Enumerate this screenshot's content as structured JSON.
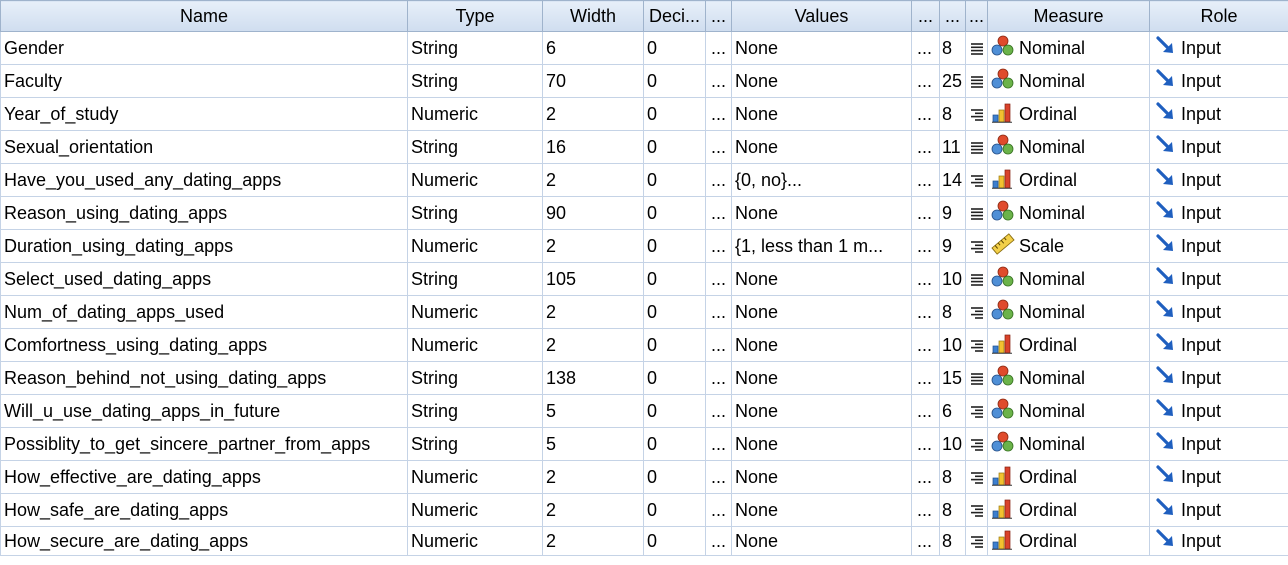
{
  "columns": {
    "name": "Name",
    "type": "Type",
    "width": "Width",
    "decimals": "Deci...",
    "label": "...",
    "values": "Values",
    "missing": "...",
    "cols": "...",
    "align": "...",
    "measure": "Measure",
    "role": "Role"
  },
  "icons": {
    "nominal": "nominal-circles-icon",
    "ordinal": "ordinal-bars-icon",
    "scale": "scale-ruler-icon",
    "input": "input-arrow-icon",
    "align_left": "align-left-icon",
    "align_right": "align-right-icon"
  },
  "rows": [
    {
      "name": "Gender",
      "type": "String",
      "width": "6",
      "decimals": "0",
      "label": "...",
      "values": "None",
      "missing": "...",
      "cols": "8",
      "align": "left",
      "measure": "Nominal",
      "role": "Input"
    },
    {
      "name": "Faculty",
      "type": "String",
      "width": "70",
      "decimals": "0",
      "label": "...",
      "values": "None",
      "missing": "...",
      "cols": "25",
      "align": "left",
      "measure": "Nominal",
      "role": "Input"
    },
    {
      "name": "Year_of_study",
      "type": "Numeric",
      "width": "2",
      "decimals": "0",
      "label": "...",
      "values": "None",
      "missing": "...",
      "cols": "8",
      "align": "right",
      "measure": "Ordinal",
      "role": "Input"
    },
    {
      "name": "Sexual_orientation",
      "type": "String",
      "width": "16",
      "decimals": "0",
      "label": "...",
      "values": "None",
      "missing": "...",
      "cols": "11",
      "align": "left",
      "measure": "Nominal",
      "role": "Input"
    },
    {
      "name": "Have_you_used_any_dating_apps",
      "type": "Numeric",
      "width": "2",
      "decimals": "0",
      "label": "...",
      "values": "{0, no}...",
      "missing": "...",
      "cols": "14",
      "align": "right",
      "measure": "Ordinal",
      "role": "Input"
    },
    {
      "name": "Reason_using_dating_apps",
      "type": "String",
      "width": "90",
      "decimals": "0",
      "label": "...",
      "values": "None",
      "missing": "...",
      "cols": "9",
      "align": "left",
      "measure": "Nominal",
      "role": "Input"
    },
    {
      "name": "Duration_using_dating_apps",
      "type": "Numeric",
      "width": "2",
      "decimals": "0",
      "label": "...",
      "values": "{1, less than 1 m...",
      "missing": "...",
      "cols": "9",
      "align": "right",
      "measure": "Scale",
      "role": "Input"
    },
    {
      "name": "Select_used_dating_apps",
      "type": "String",
      "width": "105",
      "decimals": "0",
      "label": "...",
      "values": "None",
      "missing": "...",
      "cols": "10",
      "align": "left",
      "measure": "Nominal",
      "role": "Input"
    },
    {
      "name": "Num_of_dating_apps_used",
      "type": "Numeric",
      "width": "2",
      "decimals": "0",
      "label": "...",
      "values": "None",
      "missing": "...",
      "cols": "8",
      "align": "right",
      "measure": "Nominal",
      "role": "Input"
    },
    {
      "name": "Comfortness_using_dating_apps",
      "type": "Numeric",
      "width": "2",
      "decimals": "0",
      "label": "...",
      "values": "None",
      "missing": "...",
      "cols": "10",
      "align": "right",
      "measure": "Ordinal",
      "role": "Input"
    },
    {
      "name": "Reason_behind_not_using_dating_apps",
      "type": "String",
      "width": "138",
      "decimals": "0",
      "label": "...",
      "values": "None",
      "missing": "...",
      "cols": "15",
      "align": "left",
      "measure": "Nominal",
      "role": "Input"
    },
    {
      "name": "Will_u_use_dating_apps_in_future",
      "type": "String",
      "width": "5",
      "decimals": "0",
      "label": "...",
      "values": "None",
      "missing": "...",
      "cols": "6",
      "align": "right",
      "measure": "Nominal",
      "role": "Input"
    },
    {
      "name": "Possiblity_to_get_sincere_partner_from_apps",
      "type": "String",
      "width": "5",
      "decimals": "0",
      "label": "...",
      "values": "None",
      "missing": "...",
      "cols": "10",
      "align": "right",
      "measure": "Nominal",
      "role": "Input"
    },
    {
      "name": "How_effective_are_dating_apps",
      "type": "Numeric",
      "width": "2",
      "decimals": "0",
      "label": "...",
      "values": "None",
      "missing": "...",
      "cols": "8",
      "align": "right",
      "measure": "Ordinal",
      "role": "Input"
    },
    {
      "name": "How_safe_are_dating_apps",
      "type": "Numeric",
      "width": "2",
      "decimals": "0",
      "label": "...",
      "values": "None",
      "missing": "...",
      "cols": "8",
      "align": "right",
      "measure": "Ordinal",
      "role": "Input"
    },
    {
      "name": "How_secure_are_dating_apps",
      "type": "Numeric",
      "width": "2",
      "decimals": "0",
      "label": "...",
      "values": "None",
      "missing": "...",
      "cols": "8",
      "align": "right",
      "measure": "Ordinal",
      "role": "Input"
    }
  ]
}
